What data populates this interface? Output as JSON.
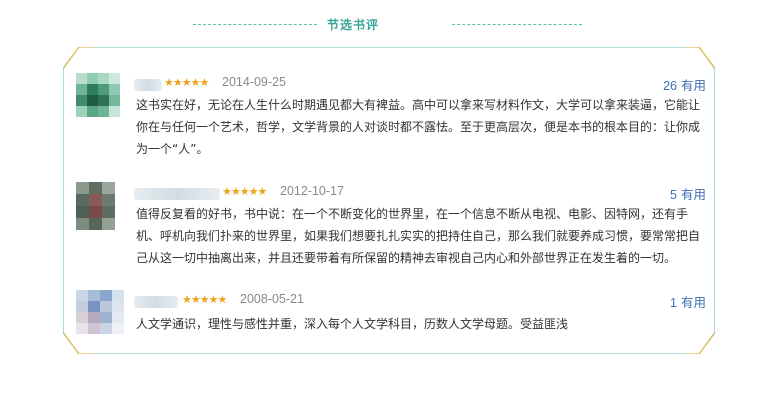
{
  "section": {
    "title": "节选书评"
  },
  "colors": {
    "accent": "#5bbfb0",
    "star": "#f0a21d",
    "link": "#3d6fb4",
    "date": "#8a8a8a",
    "frame_gold": "#e3b94a"
  },
  "reviews": [
    {
      "stars": "★★★★★",
      "rating": 5,
      "date": "2014-09-25",
      "useful_count": "26",
      "useful_label": "有用",
      "text": "这书实在好，无论在人生什么时期遇见都大有裨益。高中可以拿来写材料作文，大学可以拿来装逼，它能让你在与任何一个艺术，哲学，文学背景的人对谈时都不露怯。至于更高层次，便是本书的根本目的：让你成为一个“人”。"
    },
    {
      "stars": "★★★★★",
      "rating": 5,
      "date": "2012-10-17",
      "useful_count": "5",
      "useful_label": "有用",
      "text": "值得反复看的好书，书中说：在一个不断变化的世界里，在一个信息不断从电视、电影、因特网，还有手机、呼机向我们扑来的世界里，如果我们想要扎扎实实的把持住自己，那么我们就要养成习惯，要常常把自己从这一切中抽离出来，并且还要带着有所保留的精神去审视自己内心和外部世界正在发生着的一切。"
    },
    {
      "stars": "★★★★★",
      "rating": 5,
      "date": "2008-05-21",
      "useful_count": "1",
      "useful_label": "有用",
      "text": "人文学通识，理性与感性并重，深入每个人文学科目，历数人文学母题。受益匪浅"
    }
  ]
}
